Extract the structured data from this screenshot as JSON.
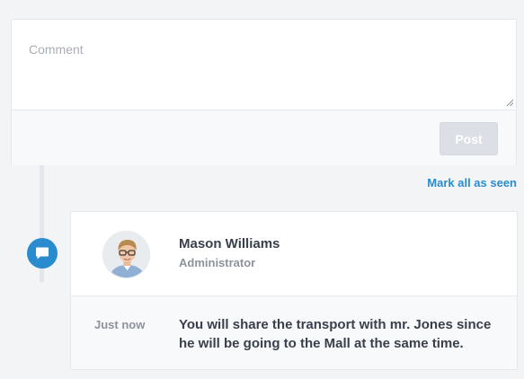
{
  "composer": {
    "placeholder": "Comment",
    "value": "",
    "post_label": "Post"
  },
  "actions": {
    "mark_all_seen_label": "Mark all as seen"
  },
  "activity": {
    "icon": "chat-bubble-icon",
    "user": {
      "name": "Mason Williams",
      "role": "Administrator"
    },
    "time": "Just now",
    "message": "You will share the transport with mr. Jones since he will be going to the Mall at the same time."
  },
  "colors": {
    "accent": "#2a8ccf",
    "background": "#f3f4f6",
    "post_disabled": "#dcdfe5"
  }
}
